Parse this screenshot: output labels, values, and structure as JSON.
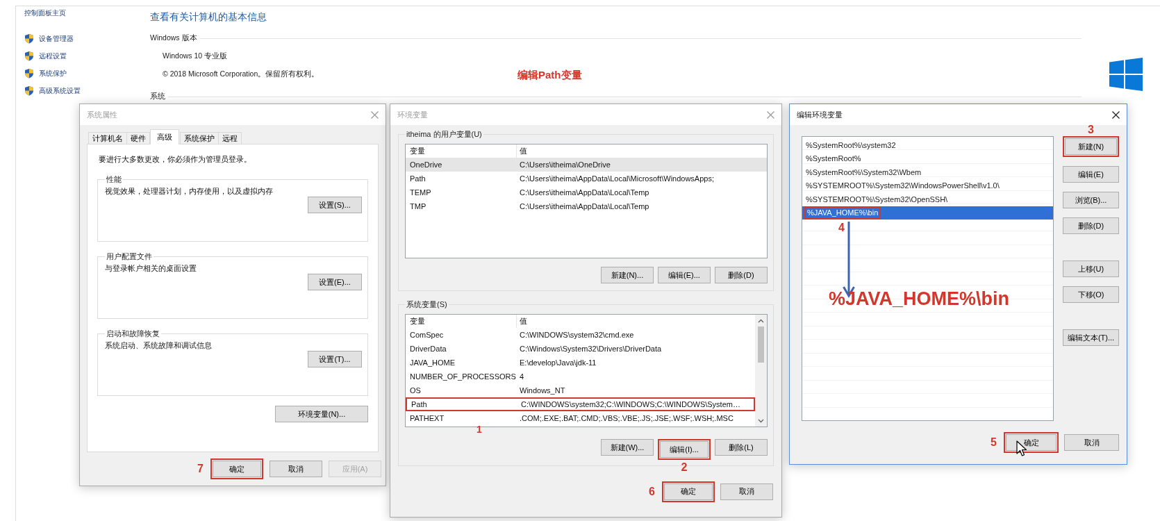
{
  "control_panel": {
    "home_link": "控制面板主页",
    "links": [
      "设备管理器",
      "远程设置",
      "系统保护",
      "高级系统设置"
    ],
    "heading": "查看有关计算机的基本信息",
    "edition_section": "Windows 版本",
    "edition": "Windows 10 专业版",
    "copyright": "© 2018 Microsoft Corporation。保留所有权利。",
    "system_section": "系统"
  },
  "caption": "编辑Path变量",
  "system_properties": {
    "title": "系统属性",
    "active": false,
    "tabs": [
      {
        "label": "计算机名",
        "selected": false
      },
      {
        "label": "硬件",
        "selected": false
      },
      {
        "label": "高级",
        "selected": true
      },
      {
        "label": "系统保护",
        "selected": false
      },
      {
        "label": "远程",
        "selected": false
      }
    ],
    "notice": "要进行大多数更改，你必须作为管理员登录。",
    "groups": [
      {
        "title": "性能",
        "description": "视觉效果，处理器计划，内存使用，以及虚拟内存",
        "button": "设置(S)..."
      },
      {
        "title": "用户配置文件",
        "description": "与登录帐户相关的桌面设置",
        "button": "设置(E)..."
      },
      {
        "title": "启动和故障恢复",
        "description": "系统启动、系统故障和调试信息",
        "button": "设置(T)..."
      }
    ],
    "environment_button": "环境变量(N)...",
    "buttons": [
      {
        "label": "确定",
        "disabled": false,
        "step": "7"
      },
      {
        "label": "取消",
        "disabled": false
      },
      {
        "label": "应用(A)",
        "disabled": true
      }
    ]
  },
  "environment_variables": {
    "title": "环境变量",
    "active": false,
    "user_group": "itheima 的用户变量(U)",
    "user_table": {
      "columns": [
        "变量",
        "值"
      ],
      "rows": [
        {
          "name": "OneDrive",
          "value": "C:\\Users\\itheima\\OneDrive",
          "selected": true
        },
        {
          "name": "Path",
          "value": "C:\\Users\\itheima\\AppData\\Local\\Microsoft\\WindowsApps;",
          "selected": false
        },
        {
          "name": "TEMP",
          "value": "C:\\Users\\itheima\\AppData\\Local\\Temp",
          "selected": false
        },
        {
          "name": "TMP",
          "value": "C:\\Users\\itheima\\AppData\\Local\\Temp",
          "selected": false
        }
      ]
    },
    "user_buttons": [
      {
        "label": "新建(N)...",
        "disabled": false
      },
      {
        "label": "编辑(E)...",
        "disabled": false
      },
      {
        "label": "删除(D)",
        "disabled": false
      }
    ],
    "system_group": "系统变量(S)",
    "system_table": {
      "columns": [
        "变量",
        "值"
      ],
      "rows": [
        {
          "name": "ComSpec",
          "value": "C:\\WINDOWS\\system32\\cmd.exe",
          "selected": false
        },
        {
          "name": "DriverData",
          "value": "C:\\Windows\\System32\\Drivers\\DriverData",
          "selected": false
        },
        {
          "name": "JAVA_HOME",
          "value": "E:\\develop\\Java\\jdk-11",
          "selected": false
        },
        {
          "name": "NUMBER_OF_PROCESSORS",
          "value": "4",
          "selected": false
        },
        {
          "name": "OS",
          "value": "Windows_NT",
          "selected": false
        },
        {
          "name": "Path",
          "value": "C:\\WINDOWS\\system32;C:\\WINDOWS;C:\\WINDOWS\\System…",
          "selected": false,
          "step": "1"
        },
        {
          "name": "PATHEXT",
          "value": ".COM;.EXE;.BAT;.CMD;.VBS;.VBE;.JS;.JSE;.WSF;.WSH;.MSC",
          "selected": false
        }
      ]
    },
    "system_buttons": [
      {
        "label": "新建(W)...",
        "disabled": false
      },
      {
        "label": "编辑(I)...",
        "disabled": false,
        "step": "2"
      },
      {
        "label": "删除(L)",
        "disabled": false
      }
    ],
    "buttons": [
      {
        "label": "确定",
        "disabled": false,
        "step": "6"
      },
      {
        "label": "取消",
        "disabled": false
      }
    ]
  },
  "edit_variable": {
    "title": "编辑环境变量",
    "active": true,
    "entries": [
      {
        "text": "%SystemRoot%\\system32",
        "selected": false
      },
      {
        "text": "%SystemRoot%",
        "selected": false
      },
      {
        "text": "%SystemRoot%\\System32\\Wbem",
        "selected": false
      },
      {
        "text": "%SYSTEMROOT%\\System32\\WindowsPowerShell\\v1.0\\",
        "selected": false
      },
      {
        "text": "%SYSTEMROOT%\\System32\\OpenSSH\\",
        "selected": false
      },
      {
        "text": "%JAVA_HOME%\\bin",
        "selected": true,
        "step": "4"
      }
    ],
    "annotation_text": "%JAVA_HOME%\\bin",
    "button_groups": [
      [
        {
          "label": "新建(N)",
          "disabled": false,
          "step": "3"
        },
        {
          "label": "编辑(E)",
          "disabled": false
        },
        {
          "label": "浏览(B)...",
          "disabled": false
        },
        {
          "label": "删除(D)",
          "disabled": false
        }
      ],
      [
        {
          "label": "上移(U)",
          "disabled": false
        },
        {
          "label": "下移(O)",
          "disabled": false
        }
      ],
      [
        {
          "label": "编辑文本(T)...",
          "disabled": false
        }
      ]
    ],
    "buttons": [
      {
        "label": "确定",
        "disabled": false,
        "step": "5"
      },
      {
        "label": "取消",
        "disabled": false
      }
    ]
  }
}
